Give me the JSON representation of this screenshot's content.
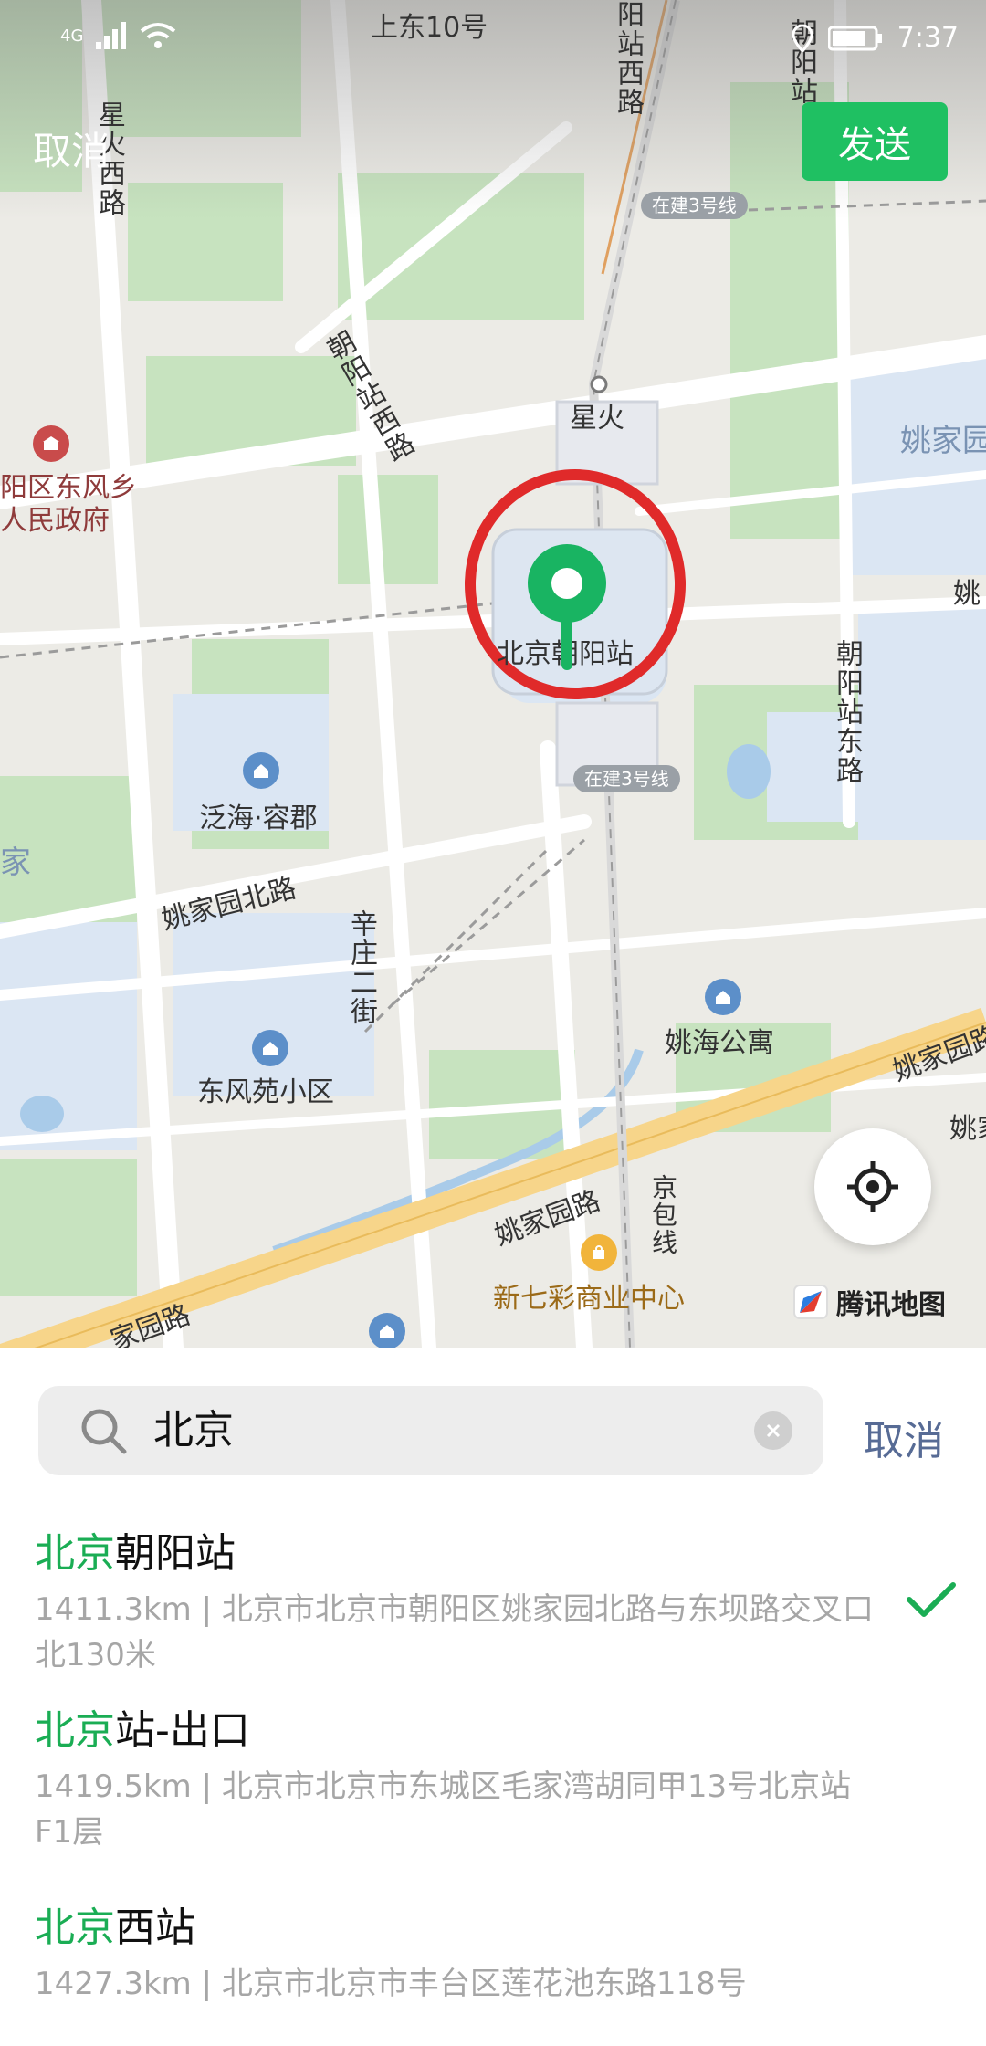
{
  "status": {
    "network": "4G",
    "time": "7:37"
  },
  "header": {
    "cancel_label": "取消",
    "send_label": "发送"
  },
  "map": {
    "labels": {
      "shangdong": "上东10号",
      "xinghuo": "星火",
      "beijing_chaoyang_station": "北京朝阳站",
      "dongfeng_gov_line1": "阳区东风乡",
      "dongfeng_gov_line2": "人民政府",
      "yaojiayuan_top": "姚家园",
      "yao_right": "姚",
      "fanhai": "泛海·容郡",
      "yaojia_left": "家",
      "yaojiayuan_north_rd": "姚家园北路",
      "xinzhuang_2nd": "辛庄二街",
      "yaohai": "姚海公寓",
      "dongfengyuan": "东风苑小区",
      "yaojiayuan_rd": "姚家园路",
      "yaojiayuan_rd_right": "姚家园路",
      "yaojia_right2": "姚家",
      "jingbao_line": "京包线",
      "xinqicai": "新七彩商业中心",
      "yuan_rd_bottom": "家园路",
      "xinghuo_west": "星火西路",
      "chaoyang_station_west": "朝阳站西路",
      "chaoyang_station_east": "朝阳站东路",
      "yang_station_west_top": "阳站西路",
      "chaoyang_station_top": "朝阳站"
    },
    "pills": {
      "line3_top": "在建3号线",
      "line3_mid": "在建3号线"
    },
    "brand": "腾讯地图"
  },
  "search": {
    "query": "北京",
    "cancel_label": "取消"
  },
  "results": [
    {
      "highlight": "北京",
      "rest": "朝阳站",
      "subtitle": "1411.3km | 北京市北京市朝阳区姚家园北路与东坝路交叉口北130米",
      "selected": true
    },
    {
      "highlight": "北京",
      "rest": "站-出口",
      "subtitle": "1419.5km | 北京市北京市东城区毛家湾胡同甲13号北京站F1层",
      "selected": false
    },
    {
      "highlight": "北京",
      "rest": "西站",
      "subtitle": "1427.3km | 北京市北京市丰台区莲花池东路118号",
      "selected": false
    }
  ],
  "colors": {
    "accent_green": "#1fc062",
    "highlight_green": "#1aad54",
    "link_blue": "#576b95",
    "marker_green": "#19b462",
    "annotation_red": "#e02a2a"
  },
  "icons": [
    "signal-icon",
    "wifi-icon",
    "location-status-icon",
    "battery-icon",
    "locate-me-icon",
    "search-icon",
    "clear-icon",
    "checkmark-icon",
    "poi-icon",
    "location-pin-icon"
  ]
}
